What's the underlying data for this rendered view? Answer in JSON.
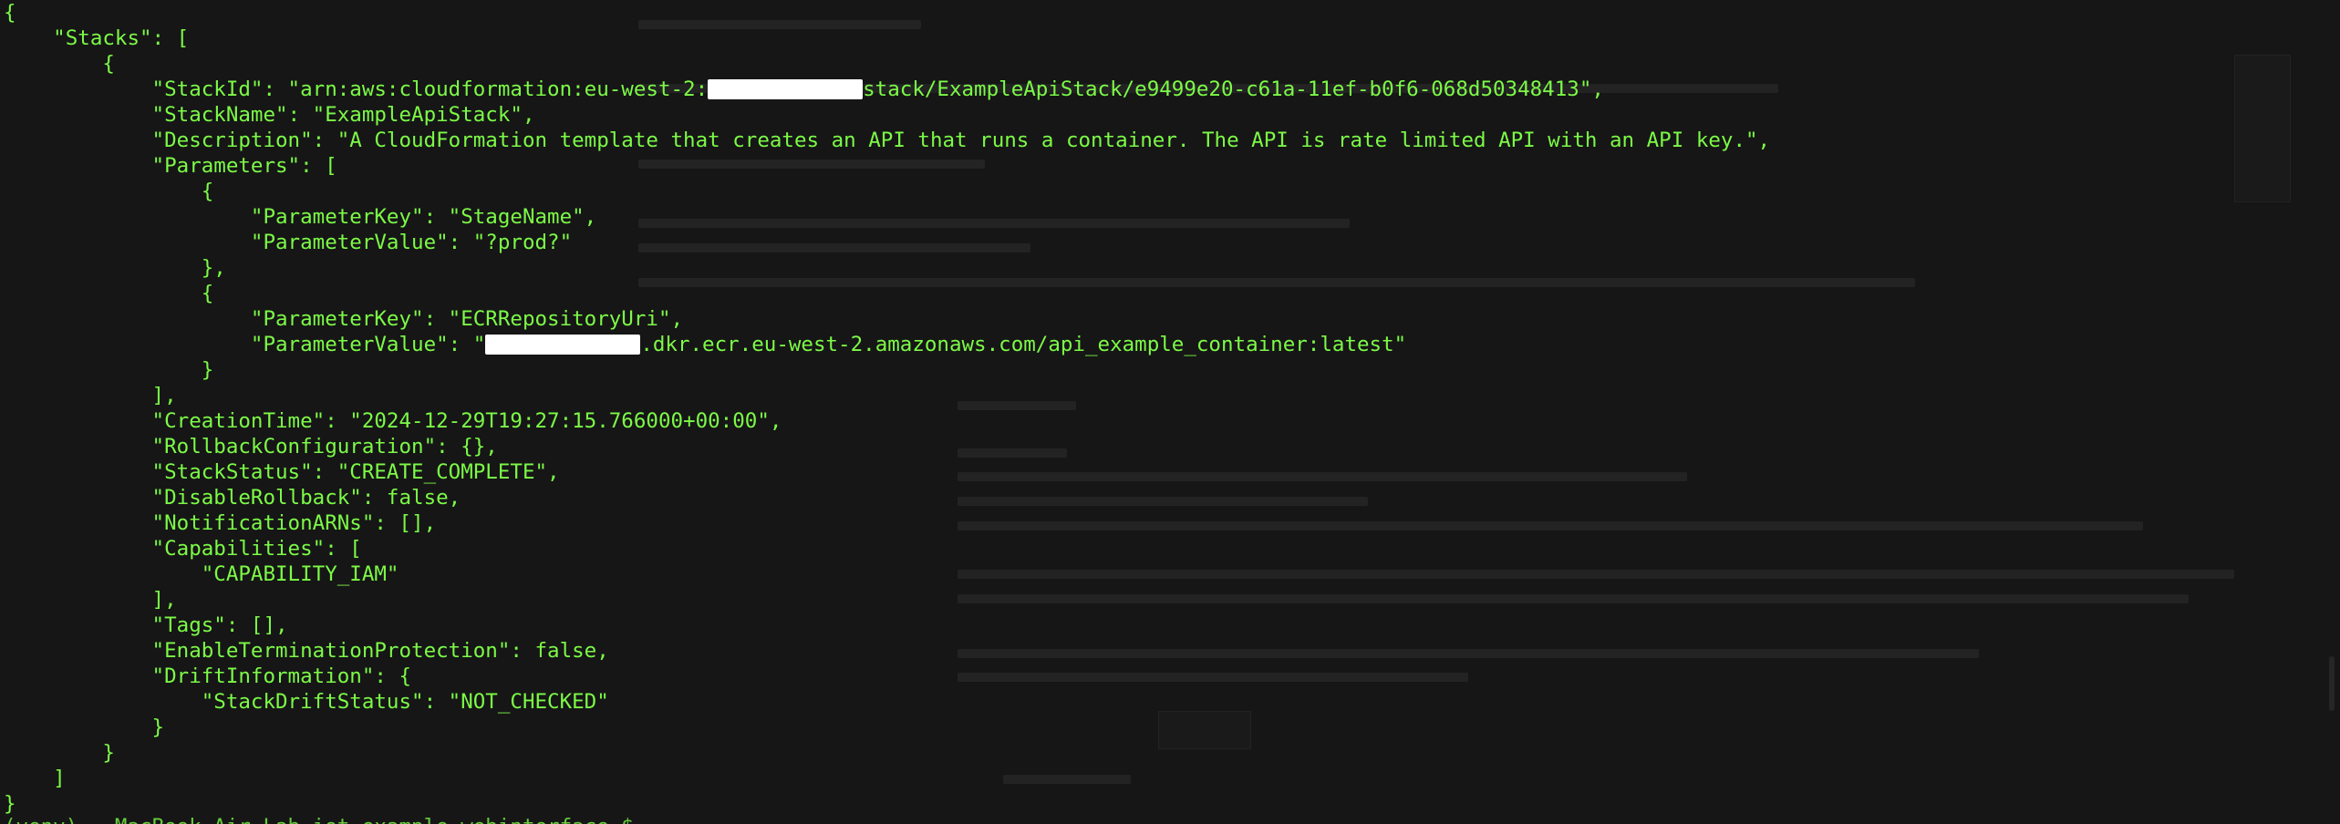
{
  "colors": {
    "background": "#161616",
    "text": "#7CFA47",
    "redaction": "#ffffff"
  },
  "lines": [
    {
      "t": "{"
    },
    {
      "t": "    \"Stacks\": ["
    },
    {
      "t": "        {"
    },
    {
      "t": "            \"StackId\": \"arn:aws:cloudformation:eu-west-2:",
      "redacted": true,
      "after": "stack/ExampleApiStack/e9499e20-c61a-11ef-b0f6-068d50348413\","
    },
    {
      "t": "            \"StackName\": \"ExampleApiStack\","
    },
    {
      "t": "            \"Description\": \"A CloudFormation template that creates an API that runs a container. The API is rate limited API with an API key.\","
    },
    {
      "t": "            \"Parameters\": ["
    },
    {
      "t": "                {"
    },
    {
      "t": "                    \"ParameterKey\": \"StageName\","
    },
    {
      "t": "                    \"ParameterValue\": \"?prod?\""
    },
    {
      "t": "                },"
    },
    {
      "t": "                {"
    },
    {
      "t": "                    \"ParameterKey\": \"ECRRepositoryUri\","
    },
    {
      "t": "                    \"ParameterValue\": \"",
      "redacted": true,
      "after": ".dkr.ecr.eu-west-2.amazonaws.com/api_example_container:latest\""
    },
    {
      "t": "                }"
    },
    {
      "t": "            ],"
    },
    {
      "t": "            \"CreationTime\": \"2024-12-29T19:27:15.766000+00:00\","
    },
    {
      "t": "            \"RollbackConfiguration\": {},"
    },
    {
      "t": "            \"StackStatus\": \"CREATE_COMPLETE\","
    },
    {
      "t": "            \"DisableRollback\": false,"
    },
    {
      "t": "            \"NotificationARNs\": [],"
    },
    {
      "t": "            \"Capabilities\": ["
    },
    {
      "t": "                \"CAPABILITY_IAM\""
    },
    {
      "t": "            ],"
    },
    {
      "t": "            \"Tags\": [],"
    },
    {
      "t": "            \"EnableTerminationProtection\": false,"
    },
    {
      "t": "            \"DriftInformation\": {"
    },
    {
      "t": "                \"StackDriftStatus\": \"NOT_CHECKED\""
    },
    {
      "t": "            }"
    },
    {
      "t": "        }"
    },
    {
      "t": "    ]"
    },
    {
      "t": "}"
    }
  ],
  "prompt": "(venv) ~ MacBook-Air Lab-iot-example-webinterface $"
}
